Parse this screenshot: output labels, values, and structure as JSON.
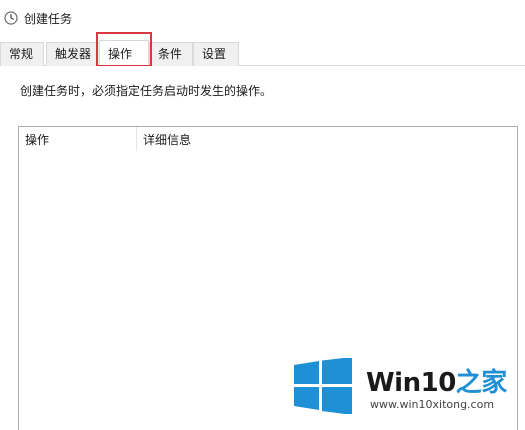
{
  "window": {
    "title": "创建任务",
    "icon": "clock-icon"
  },
  "tabs": [
    {
      "label": "常规",
      "active": false
    },
    {
      "label": "触发器",
      "active": false
    },
    {
      "label": "操作",
      "active": true
    },
    {
      "label": "条件",
      "active": false
    },
    {
      "label": "设置",
      "active": false
    }
  ],
  "panel": {
    "description": "创建任务时，必须指定任务启动时发生的操作。",
    "columns": [
      "操作",
      "详细信息"
    ],
    "rows": []
  },
  "watermark": {
    "brand_main": "Win10",
    "brand_accent": "之家",
    "url": "www.win10xitong.com"
  },
  "colors": {
    "highlight": "#d9373d",
    "logo_blue": "#1f8fd6"
  }
}
